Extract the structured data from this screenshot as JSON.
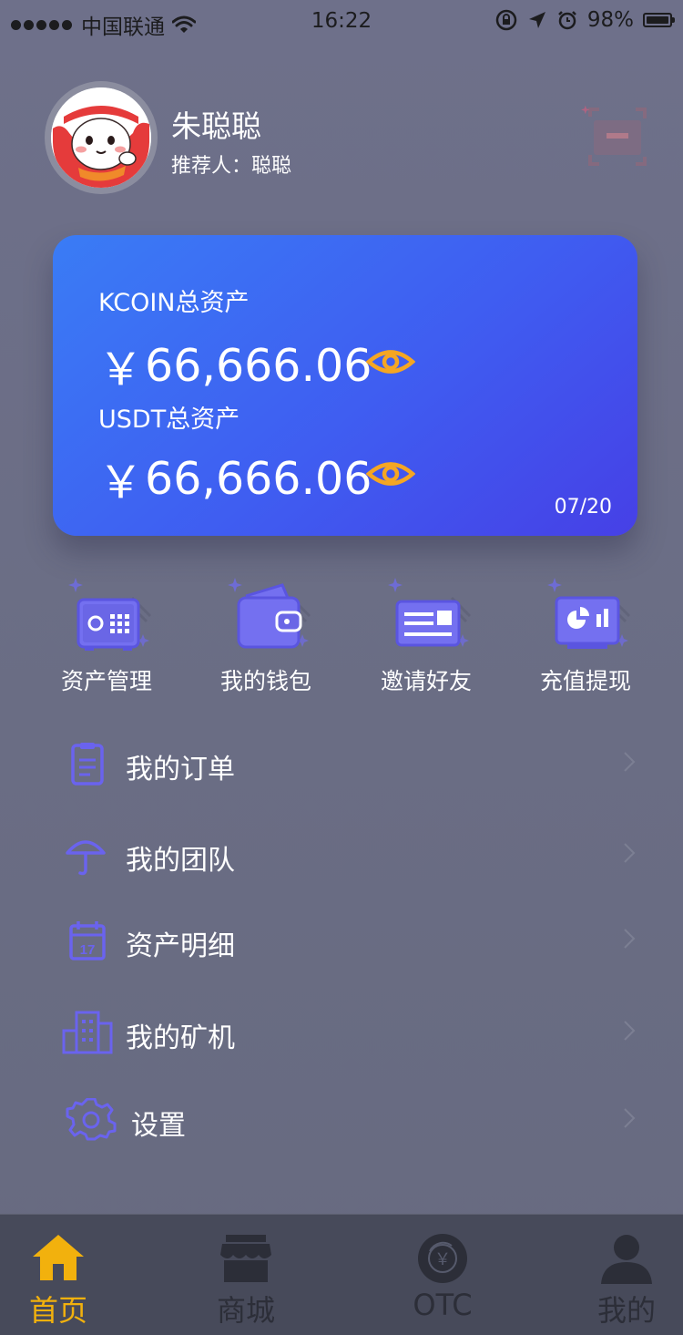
{
  "status_bar": {
    "carrier": "中国联通",
    "time": "16:22",
    "battery": "98%"
  },
  "profile": {
    "name": "朱聪聪",
    "referrer_label": "推荐人：",
    "referrer_name": "聪聪"
  },
  "asset_card": {
    "kcoin_label": "KCOIN总资产",
    "kcoin_currency": "￥",
    "kcoin_value": "66,666.06",
    "usdt_label": "USDT总资产",
    "usdt_currency": "￥",
    "usdt_value": "66,666.06",
    "date": "07/20",
    "eye_color": "#f5a623"
  },
  "quick_actions": [
    {
      "label": "资产管理",
      "icon": "safe-icon"
    },
    {
      "label": "我的钱包",
      "icon": "wallet-icon"
    },
    {
      "label": "邀请好友",
      "icon": "invite-card-icon"
    },
    {
      "label": "充值提现",
      "icon": "chart-monitor-icon"
    }
  ],
  "menu": [
    {
      "label": "我的订单",
      "icon": "clipboard-icon"
    },
    {
      "label": "我的团队",
      "icon": "umbrella-icon"
    },
    {
      "label": "资产明细",
      "icon": "calendar-icon",
      "calendar_day": "17"
    },
    {
      "label": "我的矿机",
      "icon": "building-icon"
    },
    {
      "label": "设置",
      "icon": "gear-icon"
    }
  ],
  "tab_bar": {
    "tabs": [
      {
        "label": "首页",
        "icon": "home-icon",
        "active": true
      },
      {
        "label": "商城",
        "icon": "store-icon",
        "active": false
      },
      {
        "label": "OTC",
        "icon": "otc-exchange-icon",
        "active": false
      },
      {
        "label": "我的",
        "icon": "user-icon",
        "active": false
      }
    ],
    "otc_symbol": "￥"
  },
  "colors": {
    "accent_purple": "#6a63ee",
    "active_tab": "#f2b10d",
    "card_gradient_start": "#3a7cf5",
    "card_gradient_end": "#4640e6"
  }
}
